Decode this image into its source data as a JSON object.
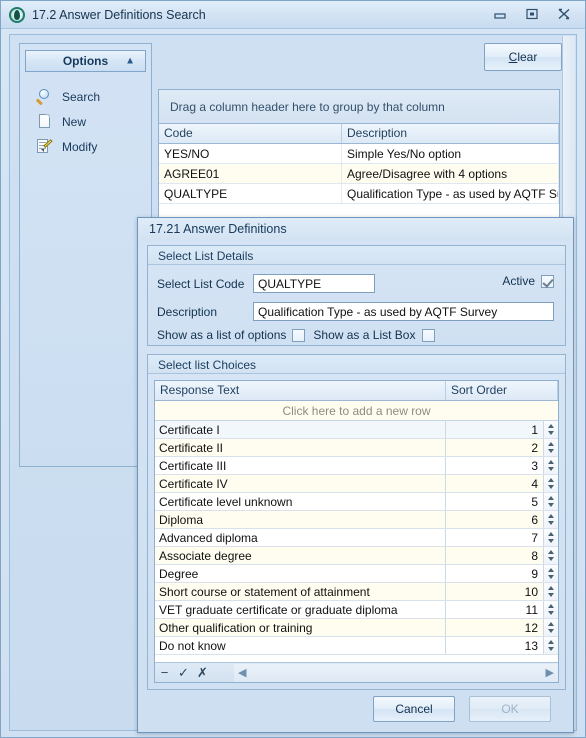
{
  "window": {
    "title": "17.2 Answer Definitions Search",
    "app_icon": "app-swirl-icon",
    "minimize": "minimize-icon",
    "maximize": "maximize-icon",
    "close": "close-icon"
  },
  "sidebar": {
    "header": "Options",
    "collapse_icon": "chevron-up-icon",
    "items": [
      {
        "label": "Search",
        "icon": "search-icon"
      },
      {
        "label": "New",
        "icon": "new-page-icon"
      },
      {
        "label": "Modify",
        "icon": "modify-page-icon"
      }
    ]
  },
  "toolbar": {
    "clear_label_accel": "C",
    "clear_label_rest": "lear"
  },
  "search_grid": {
    "group_hint": "Drag a column header here to group by that column",
    "columns": [
      "Code",
      "Description"
    ],
    "rows": [
      {
        "code": "YES/NO",
        "description": "Simple Yes/No option"
      },
      {
        "code": "AGREE01",
        "description": "Agree/Disagree with 4 options"
      },
      {
        "code": "QUALTYPE",
        "description": "Qualification Type - as used by AQTF Survey"
      }
    ]
  },
  "dialog": {
    "title": "17.21 Answer Definitions",
    "details": {
      "caption": "Select List Details",
      "code_label": "Select List Code",
      "code_value": "QUALTYPE",
      "description_label": "Description",
      "description_value": "Qualification Type - as used by AQTF Survey",
      "active_label": "Active",
      "active_checked": true,
      "show_list_options_label": "Show as a list of options",
      "show_list_options_checked": false,
      "show_list_box_label": "Show as a List Box",
      "show_list_box_checked": false
    },
    "choices": {
      "caption": "Select list Choices",
      "columns": [
        "Response Text",
        "Sort Order"
      ],
      "new_row_hint": "Click here to add a new row",
      "rows": [
        {
          "response": "Certificate I",
          "sort": "1"
        },
        {
          "response": "Certificate II",
          "sort": "2"
        },
        {
          "response": "Certificate III",
          "sort": "3"
        },
        {
          "response": "Certificate IV",
          "sort": "4"
        },
        {
          "response": "Certificate level unknown",
          "sort": "5"
        },
        {
          "response": "Diploma",
          "sort": "6"
        },
        {
          "response": "Advanced diploma",
          "sort": "7"
        },
        {
          "response": "Associate degree",
          "sort": "8"
        },
        {
          "response": "Degree",
          "sort": "9"
        },
        {
          "response": "Short course or statement of attainment",
          "sort": "10"
        },
        {
          "response": "VET graduate certificate or graduate diploma",
          "sort": "11"
        },
        {
          "response": "Other qualification or training",
          "sort": "12"
        },
        {
          "response": "Do not know",
          "sort": "13"
        }
      ],
      "footer": {
        "delete_icon": "minus-icon",
        "confirm_icon": "check-icon",
        "cancel_icon": "x-icon",
        "scroll_left_icon": "triangle-left-icon",
        "scroll_right_icon": "triangle-right-icon"
      }
    },
    "buttons": {
      "cancel": "Cancel",
      "ok": "OK",
      "ok_disabled": true
    }
  }
}
